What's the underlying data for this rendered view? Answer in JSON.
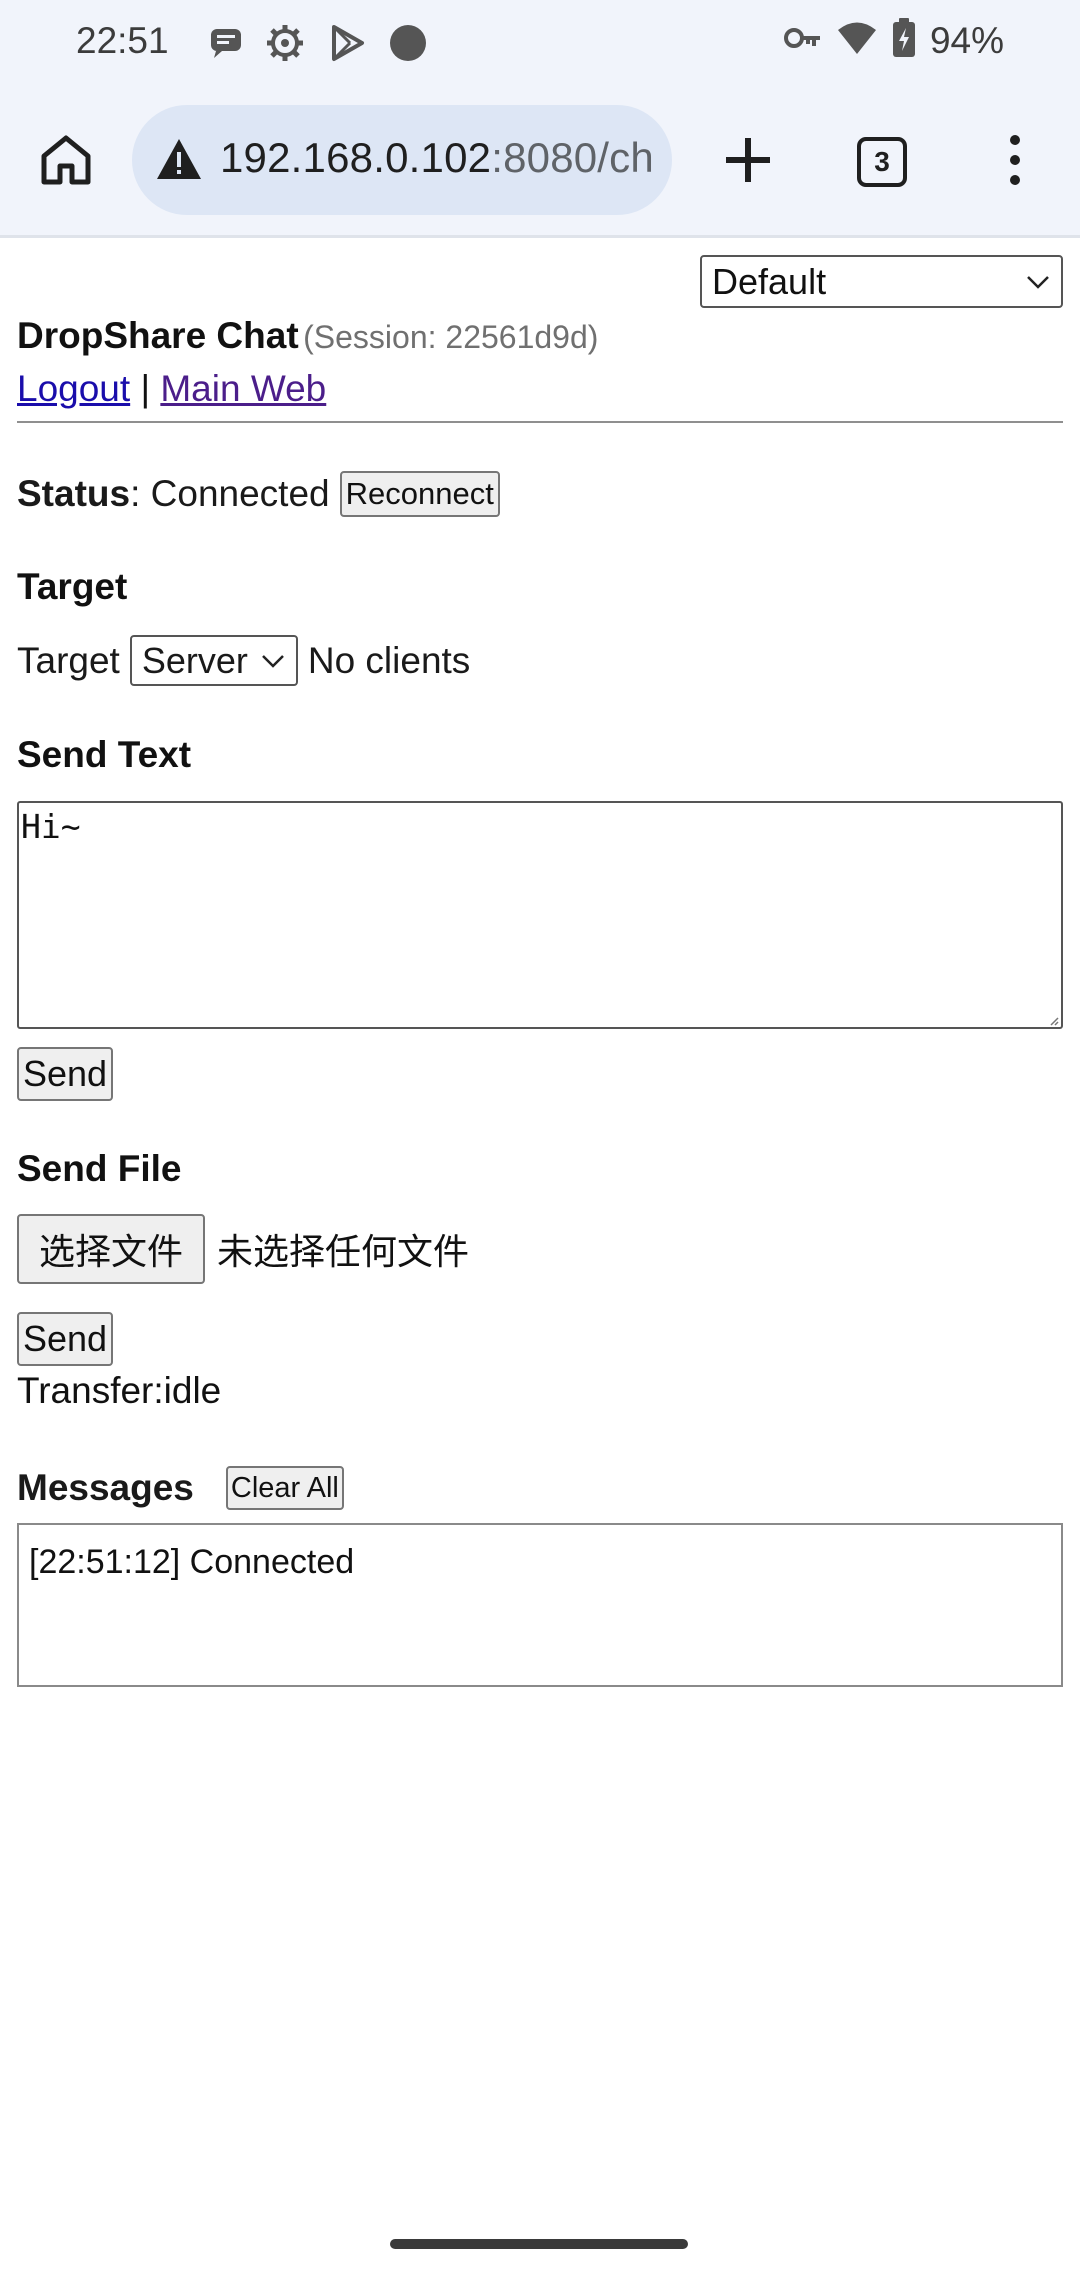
{
  "status_bar": {
    "time": "22:51",
    "battery": "94%",
    "notification_icons": [
      "chat-bubble-icon",
      "gear-icon",
      "play-store-icon",
      "circle-icon"
    ],
    "system_icons": [
      "key-icon",
      "wifi-icon",
      "battery-charging-icon"
    ]
  },
  "browser": {
    "url": "192.168.0.102:8080/ch",
    "url_host": "192.168.0.102",
    "url_rest": ":8080/ch",
    "tab_count": "3",
    "icons": [
      "home-icon",
      "warning-icon",
      "plus-icon",
      "tab-switcher-icon",
      "overflow-menu-icon"
    ]
  },
  "page": {
    "theme_select": {
      "selected": "Default"
    },
    "title": "DropShare Chat",
    "session": "(Session: 22561d9d)",
    "links": {
      "logout": "Logout",
      "separator": "|",
      "main_web": "Main Web"
    },
    "status": {
      "label": "Status",
      "colon": ":",
      "value": "Connected",
      "reconnect_button": "Reconnect"
    },
    "target": {
      "heading": "Target",
      "label": "Target",
      "selected": "Server",
      "clients_text": "No clients"
    },
    "send_text": {
      "heading": "Send Text",
      "value": "Hi~",
      "send_button": "Send"
    },
    "send_file": {
      "heading": "Send File",
      "choose_button": "选择文件",
      "no_file_text": "未选择任何文件",
      "send_button": "Send",
      "transfer": "Transfer:idle"
    },
    "messages": {
      "heading": "Messages",
      "clear_button": "Clear All",
      "items": [
        "[22:51:12] Connected"
      ]
    }
  },
  "colors": {
    "chrome_bg": "#f1f4fb",
    "url_pill": "#dde6f5",
    "link": "#1a0dab",
    "visited_link": "#4b1e8a"
  }
}
